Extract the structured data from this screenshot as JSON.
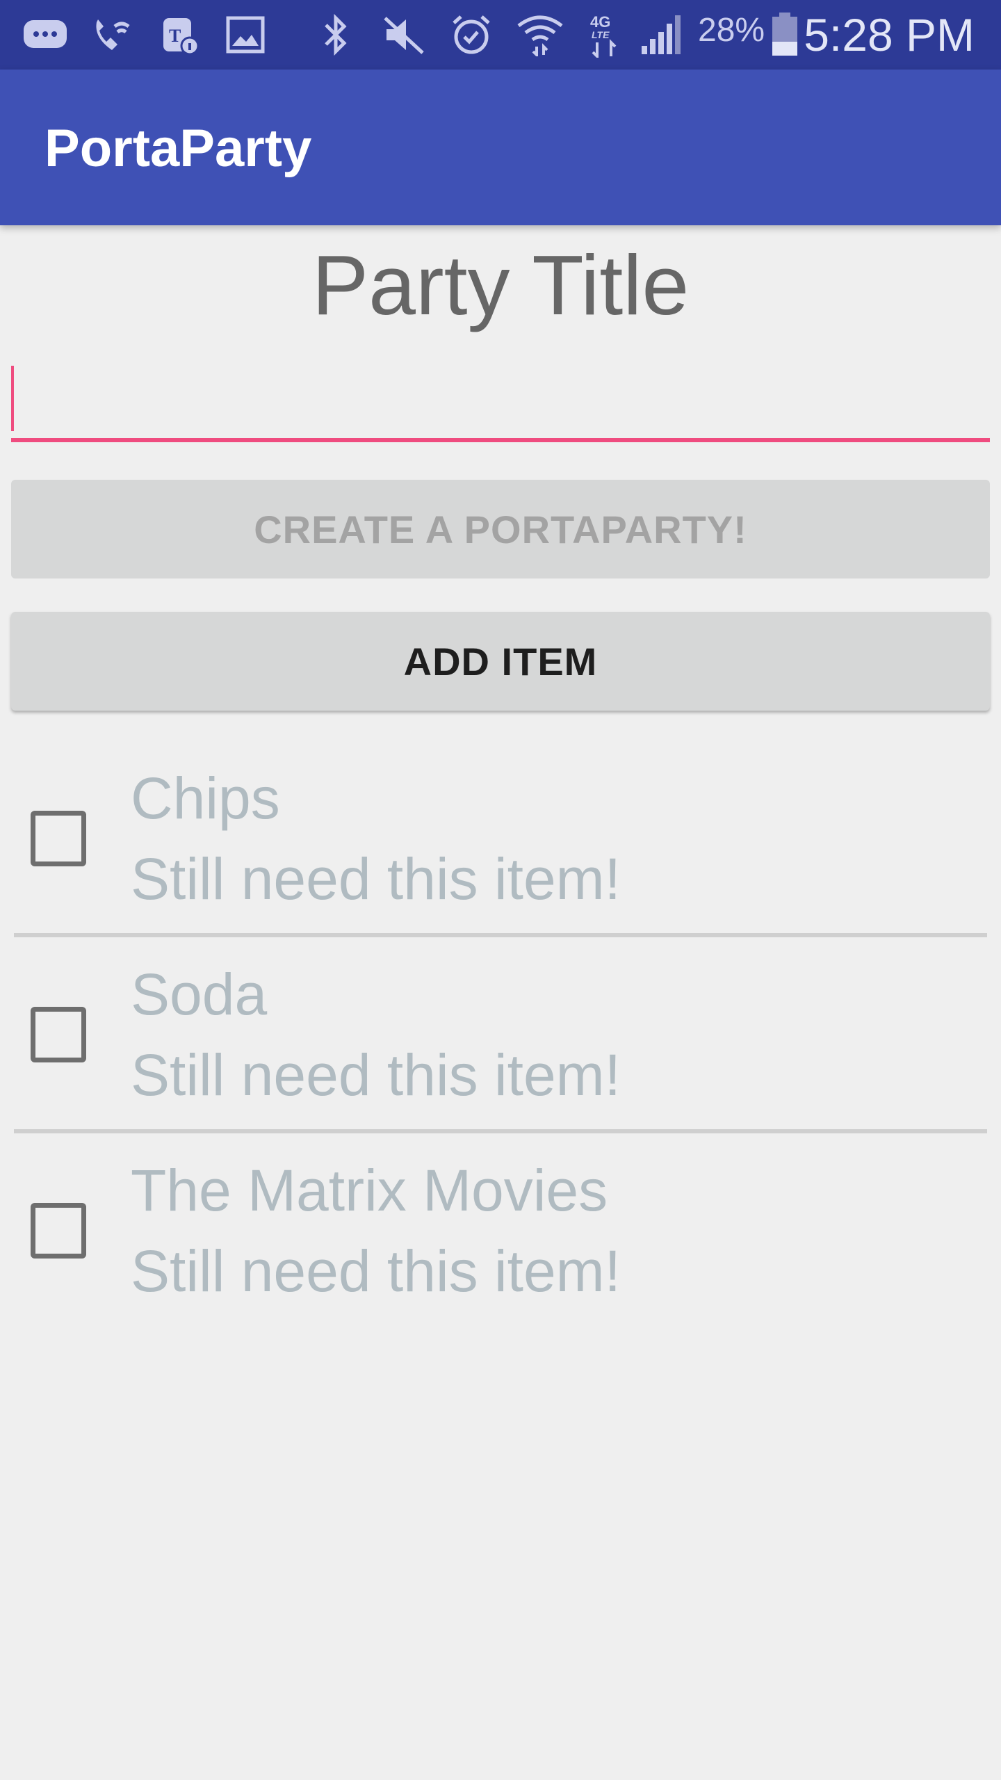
{
  "status_bar": {
    "battery_percent": "28%",
    "time": "5:28 PM",
    "icons": [
      "message-icon",
      "wifi-calling-icon",
      "tmobile-info-icon",
      "image-icon",
      "bluetooth-icon",
      "mute-icon",
      "alarm-icon",
      "wifi-icon",
      "4g-lte-icon",
      "signal-icon",
      "battery-icon"
    ]
  },
  "app_bar": {
    "title": "PortaParty"
  },
  "main": {
    "party_title_label": "Party Title",
    "title_input": {
      "value": "",
      "placeholder": ""
    },
    "create_button_label": "CREATE A PORTAPARTY!",
    "add_item_button_label": "ADD ITEM"
  },
  "items": [
    {
      "name": "Chips",
      "status": "Still need this item!",
      "checked": false
    },
    {
      "name": "Soda",
      "status": "Still need this item!",
      "checked": false
    },
    {
      "name": "The Matrix Movies",
      "status": "Still need this item!",
      "checked": false
    }
  ],
  "colors": {
    "status_bar": "#2d3a96",
    "app_bar": "#3f51b5",
    "accent": "#ef4c7f",
    "item_text": "#b0bbc1"
  }
}
